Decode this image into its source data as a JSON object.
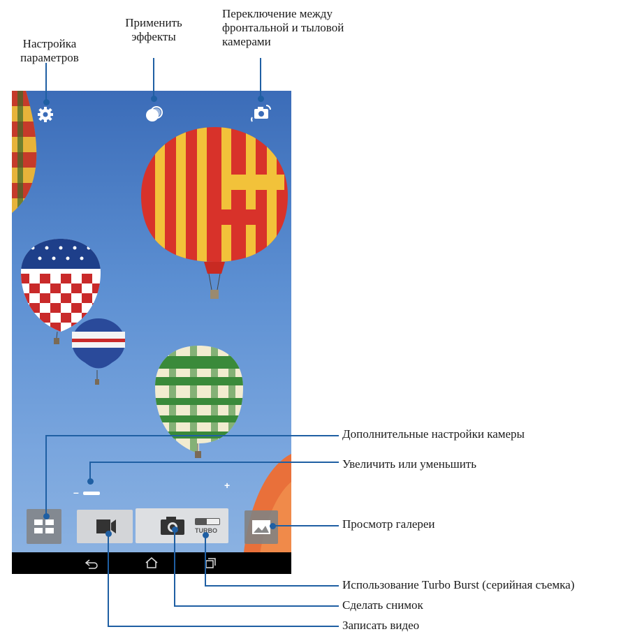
{
  "callouts": {
    "settings": "Настройка\nпараметров",
    "effects": "Применить\nэффекты",
    "switch_camera": "Переключение между\nфронтальной и тыловой\nкамерами",
    "advanced_settings": "Дополнительные настройки камеры",
    "zoom": "Увеличить или уменьшить",
    "gallery": "Просмотр галереи",
    "turbo_burst": "Использование Turbo Burst (серийная съемка)",
    "take_photo": "Сделать снимок",
    "record_video": "Записать видео"
  },
  "camera": {
    "zoom_minus": "–",
    "zoom_plus": "+",
    "turbo_label": "TURBO",
    "zoom_level": 0
  },
  "icons": {
    "settings": "gear-icon",
    "effects": "effects-icon",
    "switch": "switch-camera-icon",
    "advanced": "grid-icon",
    "video": "video-camera-icon",
    "photo": "camera-icon",
    "gallery": "gallery-icon",
    "back": "back-icon",
    "home": "home-icon",
    "recents": "recent-apps-icon"
  },
  "colors": {
    "callout_line": "#1f5fa3",
    "sky": "#5c8fd2"
  }
}
